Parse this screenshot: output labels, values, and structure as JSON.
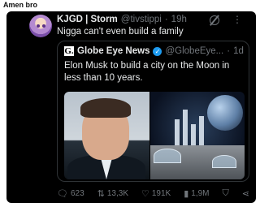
{
  "caption": "Amen bro",
  "post": {
    "display_name": "KJGD | Storm",
    "handle": "@tivstippi",
    "time": "19h",
    "text": "Nigga can't even build a family"
  },
  "quoted": {
    "logo": "G.",
    "display_name": "Globe Eye News",
    "handle": "@GlobeEye...",
    "time": "1d",
    "text": "Elon Musk to build a city on the Moon in less than 10 years."
  },
  "actions": {
    "replies": "623",
    "reposts": "13,3K",
    "likes": "191K",
    "views": "1,9M"
  },
  "colors": {
    "background": "#000000",
    "accent": "#1d9bf0",
    "muted": "#71767b"
  },
  "icons": [
    "grok-icon",
    "more-icon",
    "verified-icon",
    "reply-icon",
    "repost-icon",
    "like-icon",
    "views-icon",
    "bookmark-icon",
    "share-icon"
  ]
}
